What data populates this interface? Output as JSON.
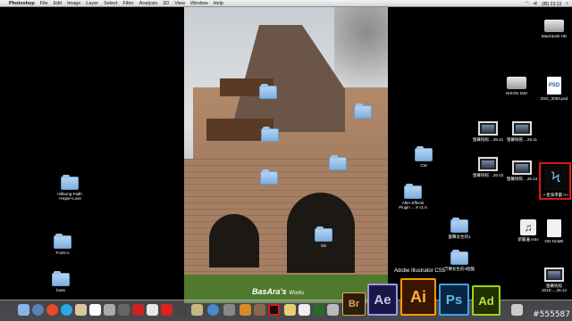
{
  "menubar": {
    "apple": "",
    "app_name": "Photoshop",
    "menus": [
      "File",
      "Edit",
      "Image",
      "Layer",
      "Select",
      "Filter",
      "Analysis",
      "3D",
      "View",
      "Window",
      "Help"
    ],
    "clock": "(四) 23:13"
  },
  "desktop": {
    "icons_left": [
      {
        "label_1": "Hillsong-Faith",
        "label_2": "+Hope+Love"
      },
      {
        "label_1": "Fonts-x",
        "label_2": ""
      },
      {
        "label_1": "fonts",
        "label_2": ""
      }
    ],
    "icons_middle": [
      {
        "label": "CW"
      },
      {
        "label_1": "After Effects",
        "label_2": "Plugin ... X v1.5"
      },
      {
        "label": "童聲女生的1"
      },
      {
        "label": "音樂女生的4個盤"
      },
      {
        "label": "SS"
      }
    ],
    "icons_right": [
      {
        "label": "Macintosh HD"
      },
      {
        "label": "NIKON D40"
      },
      {
        "label": "DSC_0083.psd"
      },
      {
        "label": "螢幕快照 ...26.41"
      },
      {
        "label": "螢幕快照 ...26.11"
      },
      {
        "label": "螢幕快照 ...26.03"
      },
      {
        "label": "螢幕快照 ...25.13"
      },
      {
        "label": "• 星海爭霸 II •"
      },
      {
        "label": "新聞邊.m4v"
      },
      {
        "label": "NO NAME"
      },
      {
        "label_1": "螢幕快照",
        "label_2": "2010-....26.14"
      }
    ]
  },
  "watermark": {
    "brand": "BasAra's",
    "suffix": "Works"
  },
  "dock": {
    "tooltip": "Adobe Illustrator CS5",
    "apps": {
      "br": "Br",
      "ae": "Ae",
      "ai": "Ai",
      "ps": "Ps",
      "ad": "Ad"
    }
  },
  "corner_watermark": "#555587"
}
